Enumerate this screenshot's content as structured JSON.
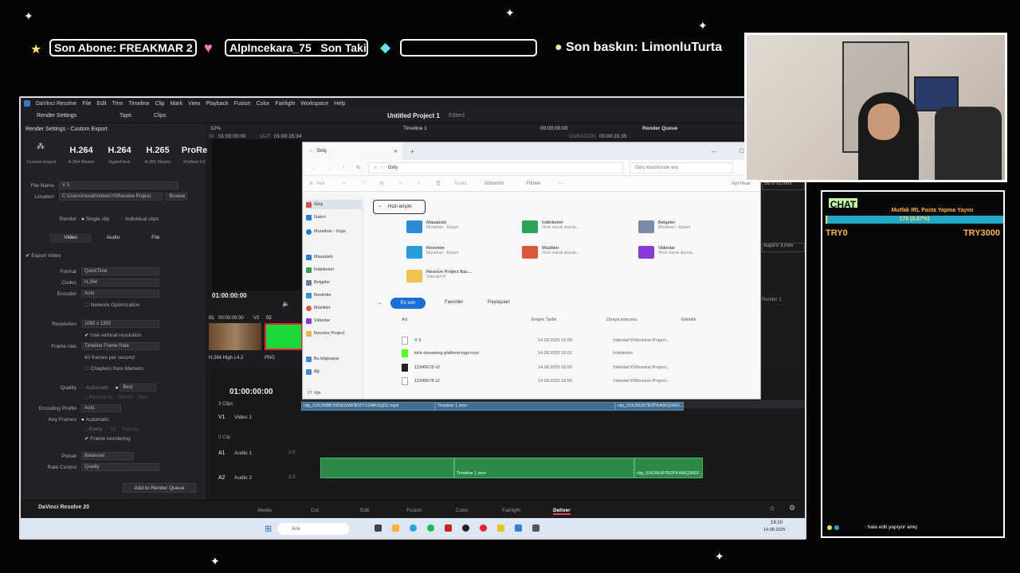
{
  "overlay": {
    "sub_label": "Son Abone: FREAKMAR 2",
    "follower_label": "AlpIncekara_75",
    "follow_suffix": "Son Takip",
    "gem_label": "",
    "raid_label": "Son baskın: LimonluTurta"
  },
  "app": {
    "title": "DaVinci Resolve",
    "menus": [
      "DaVinci Resolve",
      "File",
      "Edit",
      "Trim",
      "Timeline",
      "Clip",
      "Mark",
      "View",
      "Playback",
      "Fusion",
      "Color",
      "Fairlight",
      "Workspace",
      "Help"
    ],
    "project_title": "Untitled Project 1",
    "edited_label": "Edited",
    "toolbar": {
      "render_settings": "Render Settings",
      "tape": "Tape",
      "clips": "Clips",
      "zoom": "32%",
      "timeline_name": "Timeline 1",
      "timecode": "00:00:00:00",
      "in_label": "IN",
      "in_tc": "01:00:00:00",
      "out_label": "OUT",
      "out_tc": "01:00:15:34",
      "duration_label": "DURATION",
      "duration_tc": "00:00:15:35",
      "render_queue": "Render Queue"
    }
  },
  "render": {
    "header": "Render Settings - Custom Export",
    "presets": [
      {
        "name": "",
        "sub": "Custom Export"
      },
      {
        "name": "H.264",
        "sub": "H.264 Master"
      },
      {
        "name": "H.264",
        "sub": "HyperDeck"
      },
      {
        "name": "H.265",
        "sub": "H.265 Master"
      },
      {
        "name": "ProRe",
        "sub": "ProRes 4:2"
      }
    ],
    "file_name_label": "File Name",
    "file_name": "V 3",
    "location_label": "Location",
    "location": "C:\\Users\\murat\\Videos\\Yt\\Resolve Project",
    "browse": "Browse",
    "render_label": "Render",
    "single_clip": "Single clip",
    "individual_clips": "Individual clips",
    "tabs": [
      "Video",
      "Audio",
      "File"
    ],
    "export_video": "Export Video",
    "format_label": "Format",
    "format": "QuickTime",
    "codec_label": "Codec",
    "codec": "H.264",
    "encoder_label": "Encoder",
    "encoder": "Auto",
    "network_opt": "Network Optimization",
    "resolution_label": "Resolution",
    "resolution": "1080 x 1350",
    "use_vertical": "Use vertical resolution",
    "framerate_label": "Frame rate",
    "framerate": "Timeline Frame Rate",
    "fps_note": "60 frames per second",
    "chapters": "Chapters from Markers",
    "quality_label": "Quality",
    "quality_auto": "Automatic",
    "quality_best": "Best",
    "restrict_to": "Restrict to",
    "restrict_val": "80000",
    "kbps": "Kb/s",
    "encoding_profile_label": "Encoding Profile",
    "encoding_profile": "Auto",
    "key_frames_label": "Key Frames",
    "key_auto": "Automatic",
    "every": "Every",
    "every_val": "10",
    "frames": "frames",
    "frame_reorder": "Frame reordering",
    "preset_label": "Preset",
    "preset": "Balanced",
    "rate_control_label": "Rate Control",
    "rate_control": "Quality",
    "add_queue": "Add to Render Queue"
  },
  "viewer": {
    "timecode": "01:00:00:00",
    "clip1_tc": "00:00:09:30",
    "clip1_track": "V2",
    "clip1_num": "01",
    "clip2_num": "02",
    "clip1_label": "H.264 High L4.2",
    "clip2_label": "PNG"
  },
  "timeline": {
    "timecode": "01:00:00:00",
    "clips_count": "3 Clips",
    "v1": "V1",
    "video1": "Video 1",
    "v1_clips": "0 Clip",
    "a1": "A1",
    "audio1": "Audio 1",
    "a1_level": "2.0",
    "a2": "A2",
    "audio2": "Audio 2",
    "a2_level": "2.0",
    "clip_a": "clip_01K2M8BYWSN1WFB1FY12MKGQ0Z.mp4",
    "clip_b": "Timeline 1.mov",
    "clip_c": "clip_01K2MJ6TBZPK46KQWEF..."
  },
  "rq": {
    "item1": "5678 v2.mov",
    "item2": "kups\\V 3.mov",
    "render": "Render 1"
  },
  "pages": [
    "Media",
    "Cut",
    "Edit",
    "Fusion",
    "Color",
    "Fairlight",
    "Deliver"
  ],
  "brand": "DaVinci Resolve 20",
  "taskbar": {
    "search": "Ara",
    "time": "19:10",
    "date": "14.08.2025"
  },
  "explorer": {
    "tab": "Giriş",
    "crumb": "Giriş",
    "search": "Giriş klasöründe ara",
    "new": "Yeni",
    "sort": "Sırala",
    "view": "Görünüm",
    "filter": "Filtrele",
    "details": "Ayrıntılar",
    "nav": [
      {
        "label": "Giriş",
        "color": "#d9534f"
      },
      {
        "label": "Galeri",
        "color": "#2b7fd9"
      },
      {
        "label": "Murathan - Kişis",
        "color": "#1a7ad4"
      },
      {
        "label": "Masaüstü",
        "color": "#2b7fd9"
      },
      {
        "label": "İndirilenler",
        "color": "#2ba35a"
      },
      {
        "label": "Belgeler",
        "color": "#6b7fa3"
      },
      {
        "label": "Resimler",
        "color": "#2b9ad9"
      },
      {
        "label": "Müzikler",
        "color": "#e0563a"
      },
      {
        "label": "Videolar",
        "color": "#8a3ad9"
      },
      {
        "label": "Resolve Project",
        "color": "#e8b84a"
      },
      {
        "label": "Bu bilgisayar",
        "color": "#3a8ad9"
      },
      {
        "label": "Ağ",
        "color": "#3a8ad9"
      }
    ],
    "items_count": "27 öğe",
    "quick_access": "Hızlı erişim",
    "tiles": [
      {
        "name": "Masaüstü",
        "sub": "Murathan - Kişisel",
        "color": "#2b8ad9"
      },
      {
        "name": "İndirilenler",
        "sub": "Yerel olarak depola...",
        "color": "#2ba35a"
      },
      {
        "name": "Belgeler",
        "sub": "Murathan - Kişisel",
        "color": "#7a8aa8"
      },
      {
        "name": "Resimler",
        "sub": "Murathan - Kişisel",
        "color": "#2b9ad9"
      },
      {
        "name": "Müzikler",
        "sub": "Yerel olarak depola...",
        "color": "#e0563a"
      },
      {
        "name": "Videolar",
        "sub": "Yerel olarak depola...",
        "color": "#8a3ad9"
      },
      {
        "name": "Resolve Project Bac...",
        "sub": "Videolar\\Yt",
        "color": "#f0c24e"
      }
    ],
    "recent_tabs": [
      "En son",
      "Favoriler",
      "Paylaşılan"
    ],
    "cols": [
      "Ad",
      "Erişim Tarihi",
      "Dosya konumu",
      "Etkinlik"
    ],
    "rows": [
      {
        "name": "V 3",
        "date": "14.08.2025 19:09",
        "loc": "Videolar\\Yt\\Resolve Project..."
      },
      {
        "name": "kick-streaming-platform-logo-icon",
        "date": "14.08.2025 19:01",
        "loc": "İndirilenler"
      },
      {
        "name": "12345678 v2",
        "date": "14.08.2025 18:55",
        "loc": "Videolar\\Yt\\Resolve Project..."
      },
      {
        "name": "12345678 v2",
        "date": "14.08.2025 18:55",
        "loc": "Videolar\\Yt\\Resolve Project..."
      }
    ]
  },
  "chat": {
    "title": "CHAT",
    "stream_title": "Mutfak IRL Pasta Yapma Yayını",
    "progress_text": "176 (0.87%)",
    "progress_fraction": 0.0087,
    "goal_start": "TRY0",
    "goal_end": "TRY3000",
    "message_user": "",
    "message_text": ": hala edit yapıyor amq"
  }
}
